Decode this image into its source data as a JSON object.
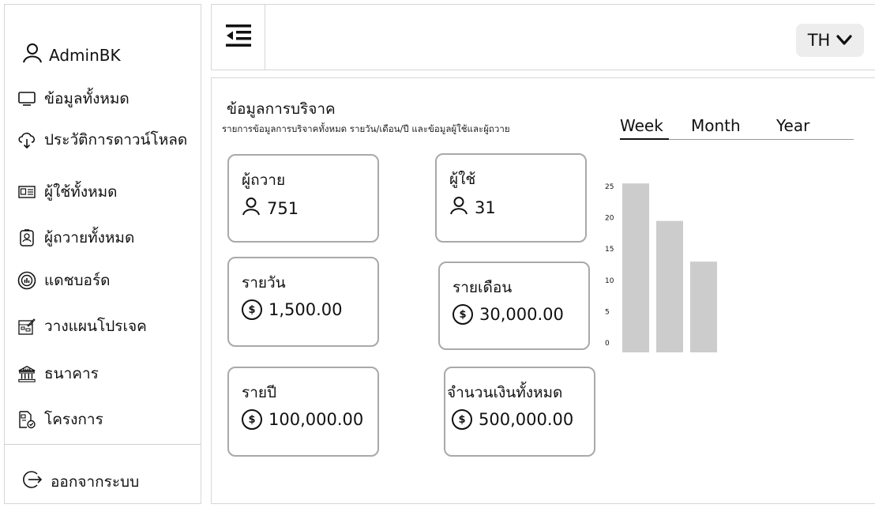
{
  "sidebar": {
    "profile_name": "AdminBK",
    "items": [
      {
        "label": "ข้อมูลทั้งหมด",
        "icon": "monitor-icon"
      },
      {
        "label": "ประวัติการดาวน์โหลด",
        "icon": "cloud-download-icon"
      },
      {
        "label": "ผู้ใช้ทั้งหมด",
        "icon": "id-card-icon"
      },
      {
        "label": "ผู้ถวายทั้งหมด",
        "icon": "badge-icon"
      },
      {
        "label": "แดชบอร์ด",
        "icon": "dashboard-icon"
      },
      {
        "label": "วางแผนโปรเจค",
        "icon": "project-plan-icon"
      },
      {
        "label": "ธนาคาร",
        "icon": "bank-icon"
      },
      {
        "label": "โครงการ",
        "icon": "project-icon"
      }
    ],
    "bank_icon_text": "BANK",
    "logout_label": "ออกจากระบบ"
  },
  "topbar": {
    "language": "TH"
  },
  "main": {
    "title": "ข้อมูลการบริจาค",
    "subtitle": "รายการข้อมูลการบริจาคทั้งหมด รายวัน/เดือน/ปี และข้อมูลผู้ใช้และผู้ถวาย",
    "tabs": [
      "Week",
      "Month",
      "Year"
    ],
    "active_tab": "Week",
    "cards": {
      "donors": {
        "label": "ผู้ถวาย",
        "value": "751"
      },
      "users": {
        "label": "ผู้ใช้",
        "value": "31"
      },
      "daily": {
        "label": "รายวัน",
        "value": "1,500.00"
      },
      "monthly": {
        "label": "รายเดือน",
        "value": "30,000.00"
      },
      "yearly": {
        "label": "รายปี",
        "value": "100,000.00"
      },
      "total": {
        "label": "จำนวนเงินทั้งหมด",
        "value": "500,000.00"
      }
    },
    "currency_symbol": "$"
  },
  "chart_data": {
    "type": "bar",
    "categories": [
      "",
      "",
      ""
    ],
    "values": [
      27,
      21,
      14.5
    ],
    "ylim": [
      0,
      25
    ],
    "yticks": [
      0,
      5,
      10,
      15,
      20,
      25
    ],
    "bar_color": "#cccccc",
    "title": "",
    "xlabel": "",
    "ylabel": ""
  }
}
